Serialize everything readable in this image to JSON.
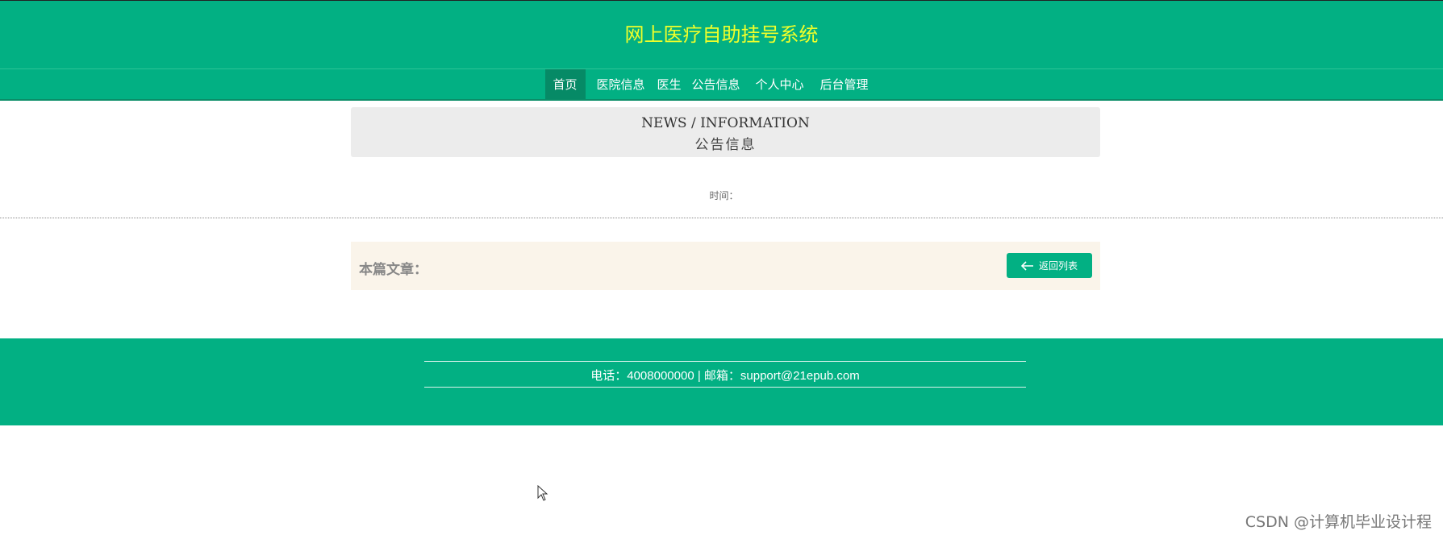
{
  "header": {
    "site_title": "网上医疗自助挂号系统"
  },
  "nav": {
    "items": [
      {
        "label": "首页",
        "active": true
      },
      {
        "label": "医院信息",
        "active": false
      },
      {
        "label": "医生",
        "active": false
      },
      {
        "label": "公告信息",
        "active": false
      },
      {
        "label": "个人中心",
        "active": false
      },
      {
        "label": "后台管理",
        "active": false
      }
    ]
  },
  "news": {
    "title_en": "NEWS / INFORMATION",
    "title_cn": "公告信息",
    "time_label": "时间："
  },
  "article": {
    "label": "本篇文章：",
    "back_button_label": "返回列表",
    "back_icon": "arrow-left-icon"
  },
  "footer": {
    "contact": "电话：4008000000 | 邮箱：support@21epub.com"
  },
  "watermark": "CSDN @计算机毕业设计程",
  "colors": {
    "primary": "#02b083",
    "title_yellow": "#f0ff2a",
    "nav_active": "#068a66",
    "banner_bg": "#ececec",
    "article_bg": "#faf4ea"
  }
}
